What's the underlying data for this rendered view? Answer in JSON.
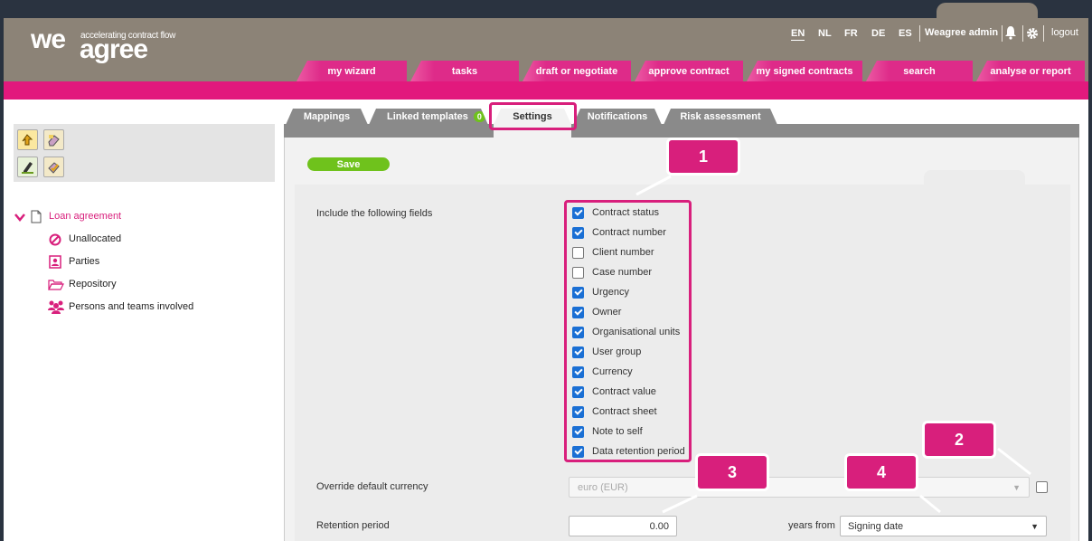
{
  "header": {
    "logo_we": "we",
    "logo_agree": "agree",
    "tagline": "accelerating contract flow",
    "languages": [
      "EN",
      "NL",
      "FR",
      "DE",
      "ES"
    ],
    "user": "Weagree admin",
    "logout": "logout"
  },
  "nav": {
    "tabs": [
      "my wizard",
      "tasks",
      "draft or negotiate",
      "approve contract",
      "my signed contracts",
      "search",
      "analyse or report"
    ]
  },
  "sidebar": {
    "root": "Loan agreement",
    "items": [
      "Unallocated",
      "Parties",
      "Repository",
      "Persons and teams involved"
    ]
  },
  "subtabs": {
    "items": [
      "Mappings",
      "Linked templates",
      "Settings",
      "Notifications",
      "Risk assessment"
    ],
    "linked_badge": "0"
  },
  "form": {
    "save": "Save",
    "include_label": "Include the following fields",
    "fields": [
      {
        "label": "Contract status",
        "checked": true
      },
      {
        "label": "Contract number",
        "checked": true
      },
      {
        "label": "Client number",
        "checked": false
      },
      {
        "label": "Case number",
        "checked": false
      },
      {
        "label": "Urgency",
        "checked": true
      },
      {
        "label": "Owner",
        "checked": true
      },
      {
        "label": "Organisational units",
        "checked": true
      },
      {
        "label": "User group",
        "checked": true
      },
      {
        "label": "Currency",
        "checked": true
      },
      {
        "label": "Contract value",
        "checked": true
      },
      {
        "label": "Contract sheet",
        "checked": true
      },
      {
        "label": "Note to self",
        "checked": true
      },
      {
        "label": "Data retention period",
        "checked": true
      }
    ],
    "currency_label": "Override default currency",
    "currency_value": "euro (EUR)",
    "retention_label": "Retention period",
    "retention_value": "0.00",
    "years_from": "years from",
    "date_value": "Signing date"
  },
  "callouts": [
    "1",
    "2",
    "3",
    "4"
  ],
  "colors": {
    "accent": "#d81f7c",
    "header": "#8c8377",
    "save": "#6fc21c",
    "checkbox": "#1a6fd4"
  }
}
